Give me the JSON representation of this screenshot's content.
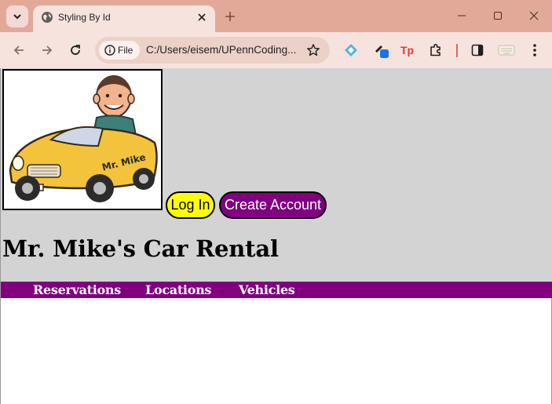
{
  "browser": {
    "tab": {
      "title": "Styling By Id"
    },
    "address": {
      "scheme_label": "File",
      "url": "C:/Users/eisem/UPennCoding..."
    }
  },
  "page": {
    "buttons": {
      "login": "Log In",
      "create_account": "Create Account"
    },
    "title": "Mr. Mike's Car Rental",
    "logo_caption": "Mr. Mike",
    "nav": [
      "Reservations",
      "Locations",
      "Vehicles"
    ]
  },
  "colors": {
    "header_bg": "#d3d3d3",
    "nav_bg": "#800080",
    "login_bg": "#ffff00",
    "create_bg": "#800080"
  }
}
